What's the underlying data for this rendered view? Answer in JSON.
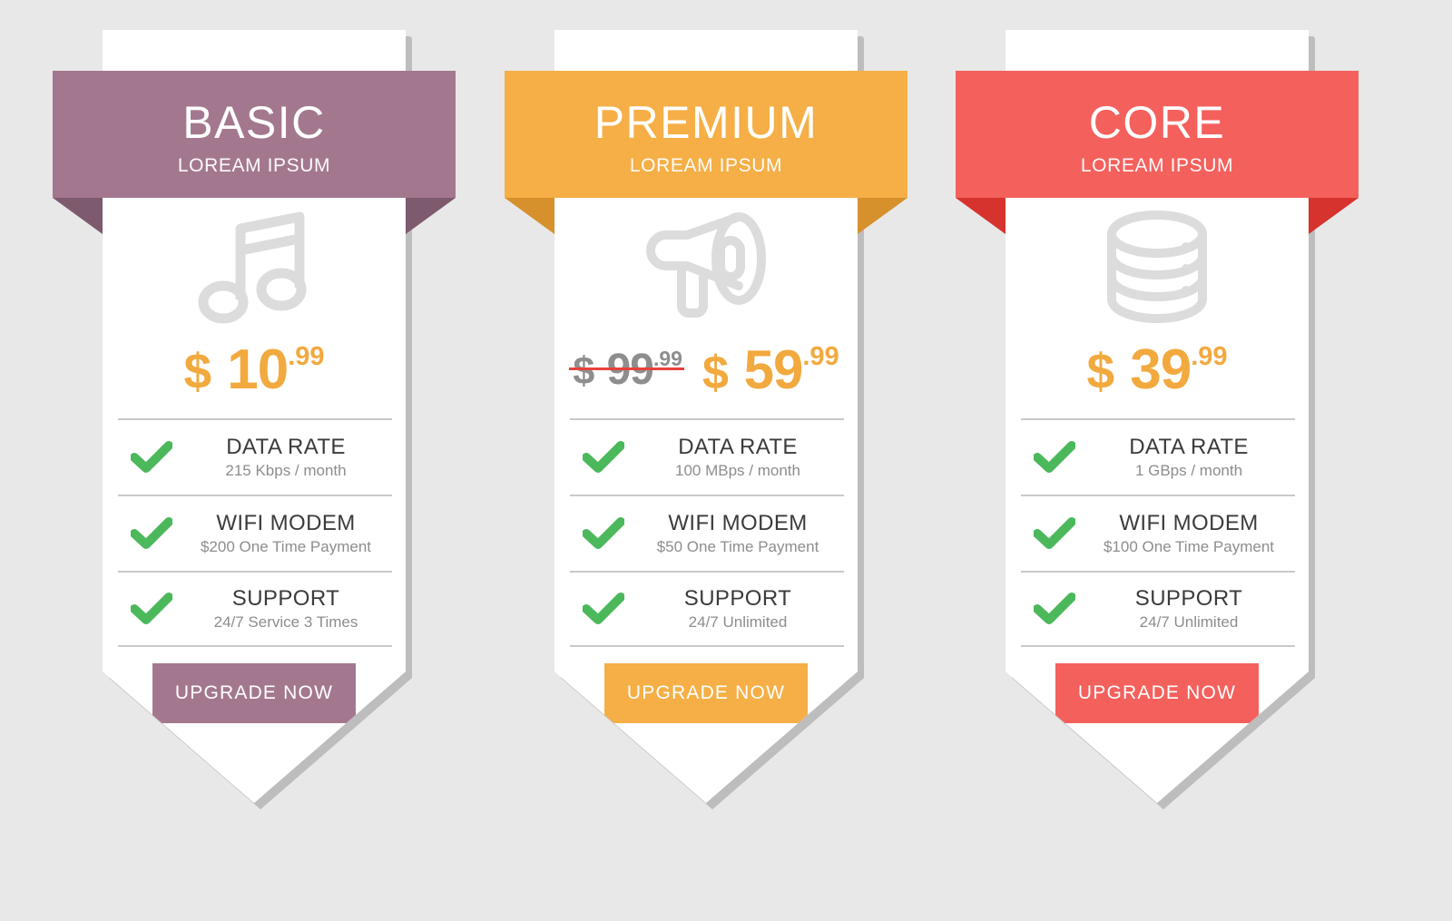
{
  "page": {
    "background": "#e8e8e8"
  },
  "common": {
    "subtitle": "LOREAM IPSUM",
    "cta_label": "UPGRADE NOW",
    "check_color": "#4cb85c",
    "icon_color": "#dcdcdc",
    "divider_color": "#c9c9c9",
    "price_color": "#f2a93e",
    "old_price_color": "#8e8e8e",
    "strike_color": "#e8413c"
  },
  "plans": [
    {
      "id": "basic",
      "name": "BASIC",
      "subtitle": "LOREAM IPSUM",
      "icon": "music-note-icon",
      "accent": "#a3788f",
      "accent_fold": "#7e5a6f",
      "price": {
        "currency": "$",
        "amount": "10",
        "cents": ".99"
      },
      "old_price": null,
      "features": [
        {
          "title": "DATA RATE",
          "desc": "215 Kbps / month"
        },
        {
          "title": "WIFI MODEM",
          "desc": "$200 One Time Payment"
        },
        {
          "title": "SUPPORT",
          "desc": "24/7 Service 3 Times"
        }
      ],
      "cta_label": "UPGRADE NOW"
    },
    {
      "id": "premium",
      "name": "PREMIUM",
      "subtitle": "LOREAM IPSUM",
      "icon": "megaphone-icon",
      "accent": "#f5af46",
      "accent_fold": "#d6912d",
      "price": {
        "currency": "$",
        "amount": "59",
        "cents": ".99"
      },
      "old_price": {
        "currency": "$",
        "amount": "99",
        "cents": ".99"
      },
      "features": [
        {
          "title": "DATA RATE",
          "desc": "100 MBps / month"
        },
        {
          "title": "WIFI MODEM",
          "desc": "$50 One Time Payment"
        },
        {
          "title": "SUPPORT",
          "desc": "24/7 Unlimited"
        }
      ],
      "cta_label": "UPGRADE NOW"
    },
    {
      "id": "core",
      "name": "CORE",
      "subtitle": "LOREAM IPSUM",
      "icon": "database-icon",
      "accent": "#f4605c",
      "accent_fold": "#d6332f",
      "price": {
        "currency": "$",
        "amount": "39",
        "cents": ".99"
      },
      "old_price": null,
      "features": [
        {
          "title": "DATA RATE",
          "desc": "1 GBps / month"
        },
        {
          "title": "WIFI MODEM",
          "desc": "$100 One Time Payment"
        },
        {
          "title": "SUPPORT",
          "desc": "24/7 Unlimited"
        }
      ],
      "cta_label": "UPGRADE NOW"
    }
  ]
}
